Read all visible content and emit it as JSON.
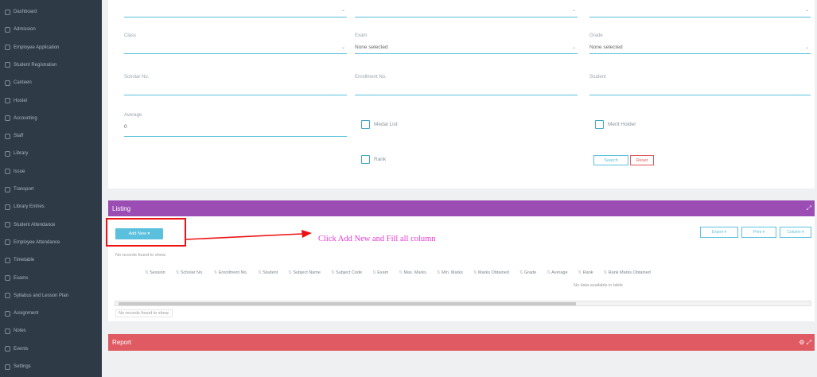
{
  "sidebar": {
    "items": [
      {
        "label": "Dashboard",
        "icon": "dashboard-icon"
      },
      {
        "label": "Admission",
        "icon": "user-plus-icon"
      },
      {
        "label": "Employee Application",
        "icon": "file-icon"
      },
      {
        "label": "Student Registration",
        "icon": "id-card-icon"
      },
      {
        "label": "Canteen",
        "icon": "cup-icon"
      },
      {
        "label": "Hostel",
        "icon": "home-icon"
      },
      {
        "label": "Accounting",
        "icon": "wallet-icon"
      },
      {
        "label": "Staff",
        "icon": "users-icon"
      },
      {
        "label": "Library",
        "icon": "book-icon"
      },
      {
        "label": "Issue",
        "icon": "tag-icon"
      },
      {
        "label": "Transport",
        "icon": "bus-icon"
      },
      {
        "label": "Library Entries",
        "icon": "list-icon"
      },
      {
        "label": "Student Attendance",
        "icon": "calendar-icon"
      },
      {
        "label": "Employee Attendance",
        "icon": "clock-icon"
      },
      {
        "label": "Timetable",
        "icon": "table-icon"
      },
      {
        "label": "Exams",
        "icon": "pencil-icon"
      },
      {
        "label": "Syllabus and Lesson Plan",
        "icon": "doc-icon"
      },
      {
        "label": "Assignment",
        "icon": "clipboard-icon"
      },
      {
        "label": "Notes",
        "icon": "note-icon"
      },
      {
        "label": "Events",
        "icon": "star-icon"
      },
      {
        "label": "Settings",
        "icon": "gear-icon"
      }
    ]
  },
  "filters": {
    "class": {
      "label": "Class",
      "value": ""
    },
    "exam": {
      "label": "Exam",
      "value": "None selected"
    },
    "grade": {
      "label": "Grade",
      "value": "None selected"
    },
    "scholar": {
      "label": "Scholar No.",
      "value": ""
    },
    "enrollment": {
      "label": "Enrollment No.",
      "value": ""
    },
    "student": {
      "label": "Student",
      "value": ""
    },
    "average": {
      "label": "Average",
      "value": "0"
    },
    "checks": {
      "medal": "Medal List",
      "merit": "Merit Holder",
      "ranks": "Rank"
    },
    "search_label": "Search",
    "reset_label": "Reset"
  },
  "listing": {
    "title": "Listing",
    "tools": "⤢",
    "add_new": "Add New ▾",
    "exports": [
      "Export ▾",
      "Print ▾",
      "Column ▾"
    ],
    "records_top": "No records found to show.",
    "records_bottom": "No records found to show.",
    "no_data": "No data available in table",
    "columns": [
      "Session",
      "Scholar No.",
      "Enrollment No.",
      "Student",
      "Subject Name",
      "Subject Code",
      "Exam",
      "Max. Marks",
      "Min. Marks",
      "Marks Obtained",
      "Grade",
      "Average",
      "Rank",
      "Rank Marks Obtained"
    ]
  },
  "report": {
    "title": "Report",
    "tools": "⚙ ⤢"
  },
  "annotation": {
    "text": "Click Add New and Fill all column",
    "color": "#e83ad6",
    "box_color": "#ee1111"
  }
}
